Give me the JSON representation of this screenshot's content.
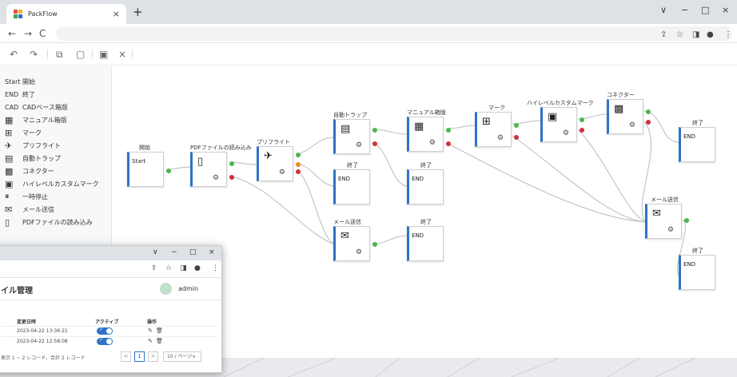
{
  "browser": {
    "tab_title": "PackFlow",
    "tab_close": "×",
    "new_tab": "+",
    "window_controls": [
      "∨",
      "−",
      "□",
      "×"
    ],
    "nav": {
      "back": "←",
      "forward": "→",
      "reload": "C"
    },
    "omnibox_icons": [
      "share-icon",
      "star-icon",
      "sidebar-icon",
      "profile-icon",
      "menu-icon"
    ]
  },
  "toolbar": {
    "icons": [
      "undo-icon",
      "redo-icon",
      "copy-icon",
      "paste-icon",
      "save-icon",
      "close-icon"
    ],
    "close_label": "×"
  },
  "palette": [
    {
      "icon": "Start",
      "icon_name": "start-icon",
      "label": "開始"
    },
    {
      "icon": "END",
      "icon_name": "end-icon",
      "label": "終了"
    },
    {
      "icon": "CAD",
      "icon_name": "cad-icon",
      "label": "CADベース箱版"
    },
    {
      "icon": "▦",
      "icon_name": "manual-board-icon",
      "label": "マニュアル箱版"
    },
    {
      "icon": "⊞",
      "icon_name": "mark-icon",
      "label": "マーク"
    },
    {
      "icon": "✈",
      "icon_name": "preflight-icon",
      "label": "プリフライト"
    },
    {
      "icon": "▤",
      "icon_name": "auto-trap-icon",
      "label": "自動トラップ"
    },
    {
      "icon": "▩",
      "icon_name": "connector-icon",
      "label": "コネクター"
    },
    {
      "icon": "▣",
      "icon_name": "high-level-custom-mark-icon",
      "label": "ハイレベルカスタムマーク"
    },
    {
      "icon": "⏸",
      "icon_name": "pause-icon",
      "label": "一時停止"
    },
    {
      "icon": "✉",
      "icon_name": "mail-icon",
      "label": "メール送信"
    },
    {
      "icon": "▯",
      "icon_name": "pdf-icon",
      "label": "PDFファイルの読み込み"
    }
  ],
  "flow": {
    "nodes": [
      {
        "id": "start",
        "title": "開始",
        "text": "Start"
      },
      {
        "id": "pdf",
        "title": "PDFファイルの読み込み",
        "icon": "▯"
      },
      {
        "id": "preflight",
        "title": "プリフライト",
        "icon": "✈"
      },
      {
        "id": "autotrap",
        "title": "自動トラップ",
        "icon": "▤"
      },
      {
        "id": "end1",
        "title": "終了",
        "text": "END"
      },
      {
        "id": "mail1",
        "title": "メール送信",
        "icon": "✉"
      },
      {
        "id": "manual",
        "title": "マニュアル箱版",
        "icon": "▦"
      },
      {
        "id": "end2",
        "title": "終了",
        "text": "END"
      },
      {
        "id": "end3",
        "title": "終了",
        "text": "END"
      },
      {
        "id": "mark",
        "title": "マーク",
        "icon": "⊞"
      },
      {
        "id": "hlmark",
        "title": "ハイレベルカスタムマーク",
        "icon": "▣"
      },
      {
        "id": "connector",
        "title": "コネクター",
        "icon": "▩"
      },
      {
        "id": "end4",
        "title": "終了",
        "text": "END"
      },
      {
        "id": "mail2",
        "title": "メール送信",
        "icon": "✉"
      },
      {
        "id": "end5",
        "title": "終了",
        "text": "END"
      }
    ],
    "gear": "⚙"
  },
  "window2": {
    "controls": [
      "∨",
      "−",
      "□",
      "×"
    ],
    "page_title": "イル管理",
    "user": "admin",
    "columns": [
      "変更日時",
      "アクティブ",
      "操作"
    ],
    "rows": [
      {
        "date": "2023-04-22 13:36:21",
        "active": true
      },
      {
        "date": "2023-04-22 12:58:08",
        "active": true
      }
    ],
    "toggle_check": "✓",
    "ops": [
      "✎",
      "🗑"
    ],
    "pager": {
      "summary": "表示 1 ~ 2 レコード、合計 2 レコード",
      "prev": "<",
      "current": "1",
      "next": ">",
      "page_size": "10 / ページ∨"
    }
  }
}
